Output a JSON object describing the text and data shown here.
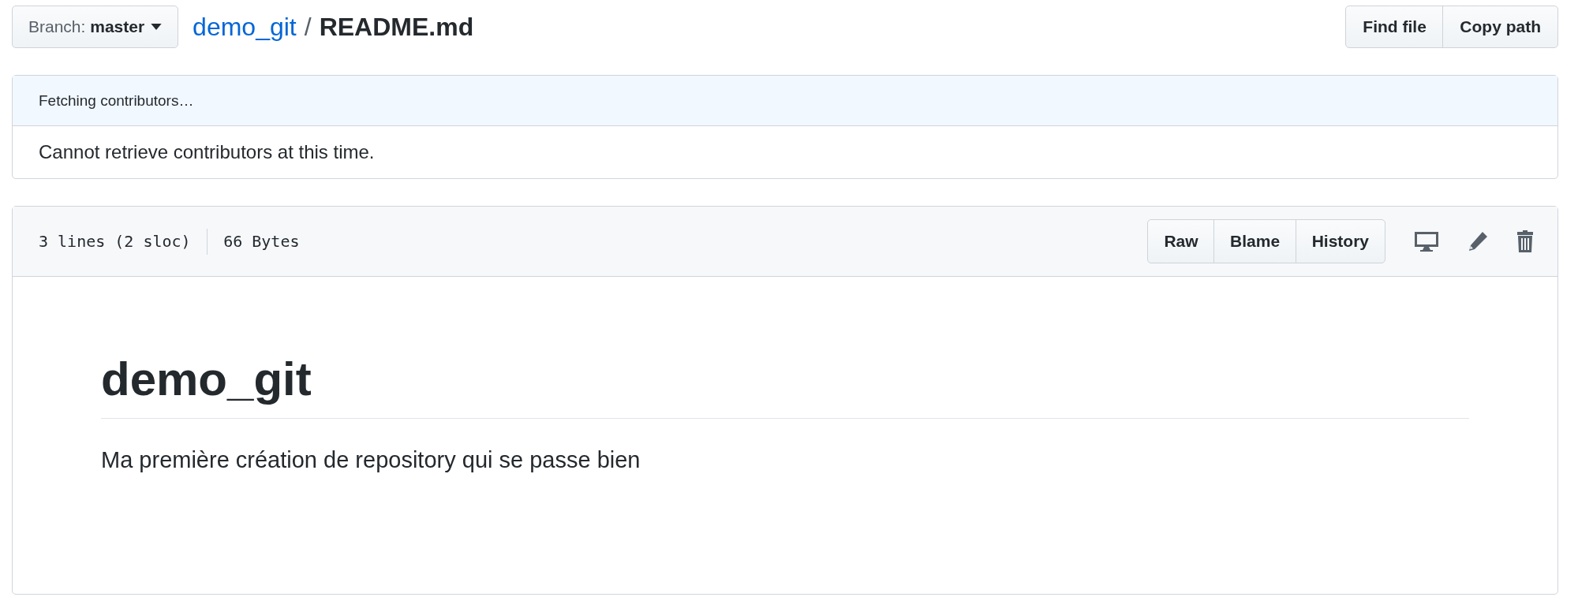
{
  "branch": {
    "label": "Branch:",
    "name": "master"
  },
  "breadcrumb": {
    "repo": "demo_git",
    "separator": "/",
    "file": "README.md"
  },
  "file_actions": [
    "Find file",
    "Copy path"
  ],
  "contributors": {
    "status": "Fetching contributors…",
    "message": "Cannot retrieve contributors at this time."
  },
  "file_info": {
    "lines": "3 lines (2 sloc)",
    "size": "66 Bytes"
  },
  "view_buttons": [
    "Raw",
    "Blame",
    "History"
  ],
  "tool_icons": [
    {
      "kind": "desktop"
    },
    {
      "kind": "pencil"
    },
    {
      "kind": "trash"
    }
  ],
  "readme": {
    "heading": "demo_git",
    "paragraph": "Ma première création de repository qui se passe bien"
  }
}
